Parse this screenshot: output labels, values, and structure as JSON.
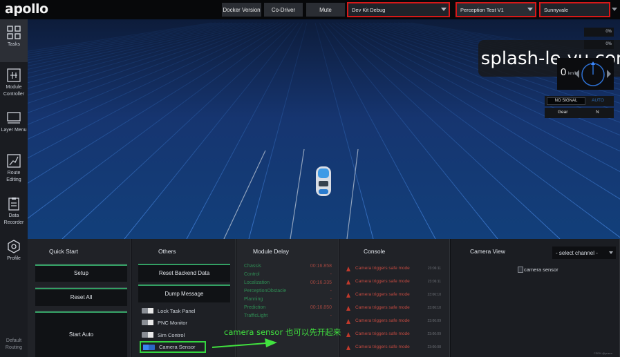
{
  "topbar": {
    "logo": "apollo",
    "buttons": {
      "docker": "Docker Version",
      "codriver": "Co-Driver",
      "mute": "Mute"
    },
    "mode_select": "Dev Kit Debug",
    "vehicle_select": "Perception Test V1",
    "map_select": "Sunnyvale"
  },
  "sidebar": {
    "items": [
      {
        "label": "Tasks",
        "icon": "grid-icon"
      },
      {
        "label": "Module Controller",
        "icon": "sliders-icon"
      },
      {
        "label": "Layer Menu",
        "icon": "layers-icon"
      },
      {
        "label": "Route Editing",
        "icon": "route-icon"
      },
      {
        "label": "Data Recorder",
        "icon": "clipboard-icon"
      },
      {
        "label": "Profile",
        "icon": "hexagon-icon"
      }
    ],
    "footer": "Default Routing"
  },
  "scene": {
    "watermark": "splash-le-yu.com",
    "status": {
      "throttle_pct": "0%",
      "brake_pct": "0%",
      "speed": "0",
      "speed_unit": "km/h",
      "signal": "NO SIGNAL",
      "drive_mode": "AUTO",
      "gear_label": "Gear",
      "gear_value": "N"
    }
  },
  "quick_start": {
    "title": "Quick Start",
    "setup": "Setup",
    "reset_all": "Reset All",
    "start_auto": "Start Auto"
  },
  "others": {
    "title": "Others",
    "reset_backend": "Reset Backend Data",
    "dump_message": "Dump Message",
    "toggles": [
      {
        "label": "Lock Task Panel",
        "on": false
      },
      {
        "label": "PNC Monitor",
        "on": false
      },
      {
        "label": "Sim Control",
        "on": false
      },
      {
        "label": "Camera Sensor",
        "on": true
      }
    ]
  },
  "module_delay": {
    "title": "Module Delay",
    "rows": [
      {
        "name": "Chassis",
        "value": "00:16.858"
      },
      {
        "name": "Control",
        "value": "-"
      },
      {
        "name": "Localization",
        "value": "00:16.335"
      },
      {
        "name": "PerceptionObstacle",
        "value": "-"
      },
      {
        "name": "Planning",
        "value": "-"
      },
      {
        "name": "Prediction",
        "value": "00:16.850"
      },
      {
        "name": "TrafficLight",
        "value": "-"
      }
    ]
  },
  "console": {
    "title": "Console",
    "logs": [
      {
        "msg": "Camera triggers safe mode",
        "time": "23:06:11"
      },
      {
        "msg": "Camera triggers safe mode",
        "time": "23:06:11"
      },
      {
        "msg": "Camera triggers safe mode",
        "time": "23:06:10"
      },
      {
        "msg": "Camera triggers safe mode",
        "time": "23:06:10"
      },
      {
        "msg": "Camera triggers safe mode",
        "time": "23:06:09"
      },
      {
        "msg": "Camera triggers safe mode",
        "time": "23:06:09"
      },
      {
        "msg": "Camera triggers safe mode",
        "time": "23:06:08"
      }
    ]
  },
  "camera_view": {
    "title": "Camera View",
    "channel_placeholder": "- select channel -",
    "image_alt": "camera sensor",
    "footer": "CSDN @yusen"
  },
  "annotation": "camera sensor 也可以先开起来",
  "colors": {
    "accent_green": "#33d63f",
    "highlight_red": "#d81818",
    "toggle_on": "#2b67c5",
    "delay_name": "#2f8d54",
    "delay_value": "#a0463f"
  }
}
